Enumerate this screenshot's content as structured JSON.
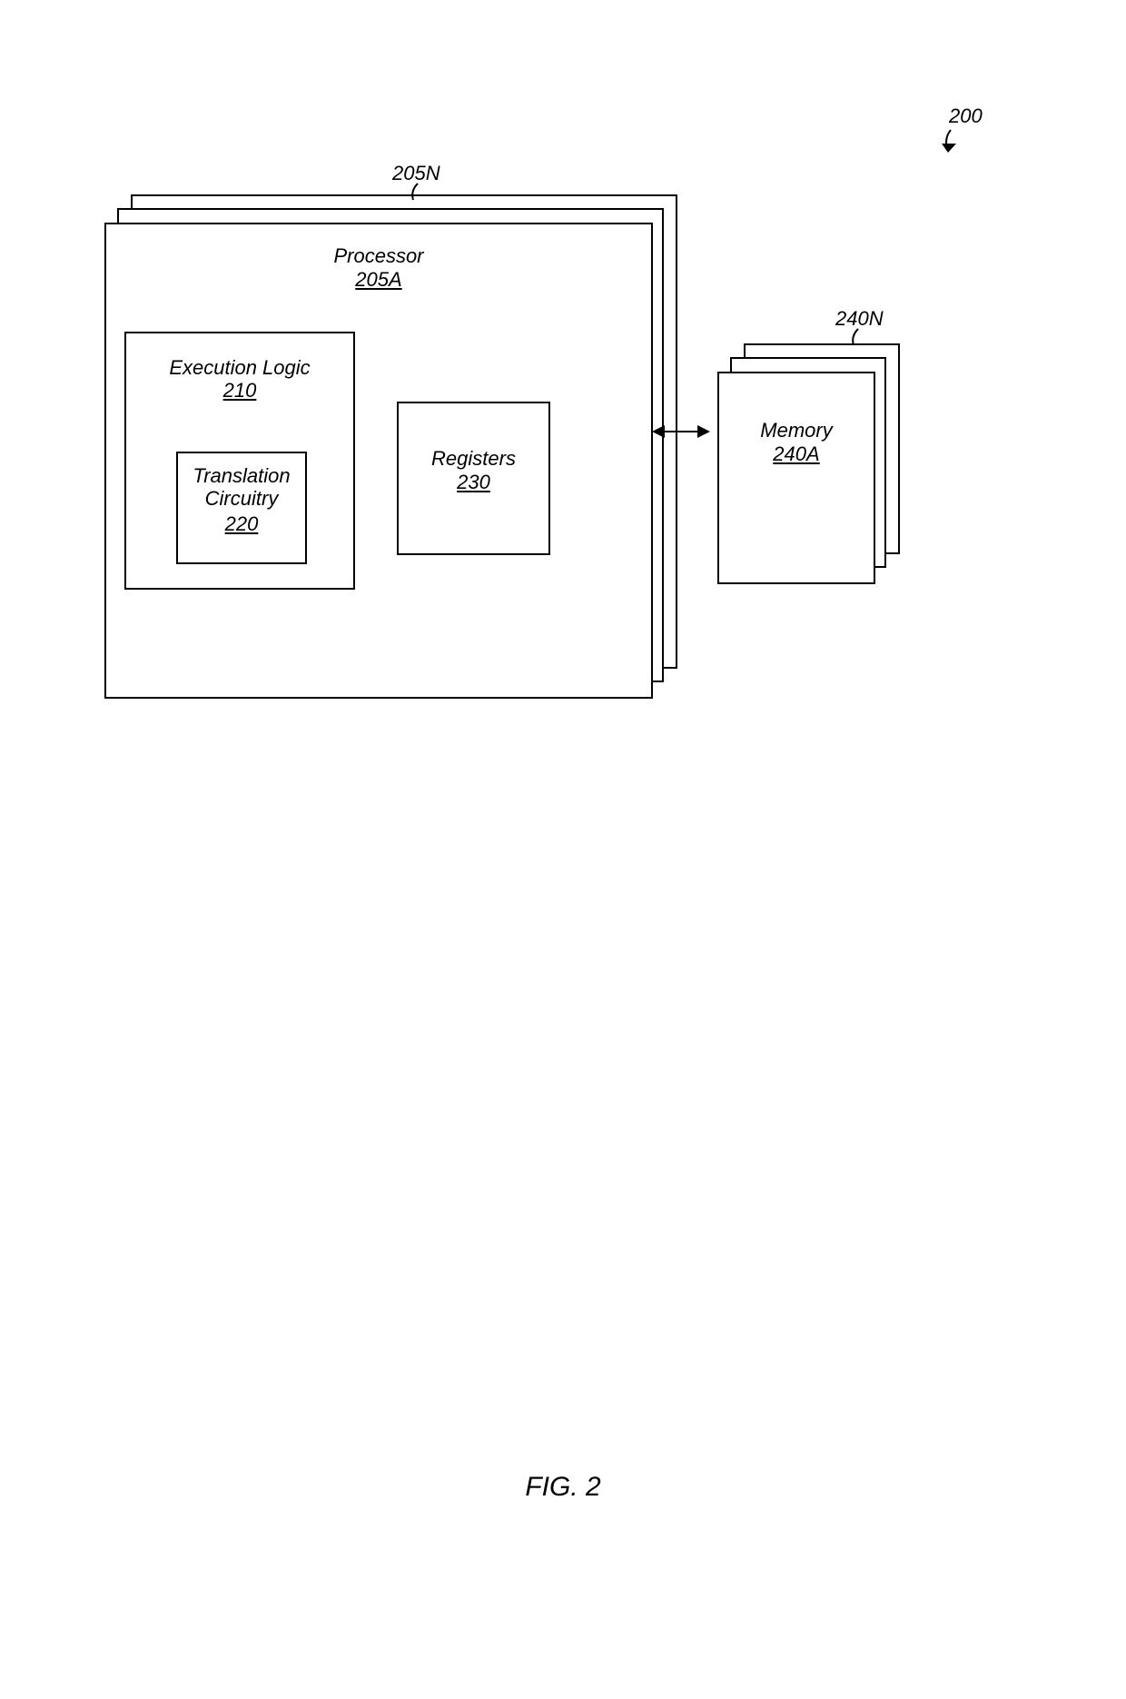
{
  "figure": {
    "overall_ref": "200",
    "caption": "FIG. 2",
    "processors": {
      "stack_ref": "205N",
      "front": {
        "title": "Processor",
        "ref": "205A",
        "execution_logic": {
          "title": "Execution Logic",
          "ref": "210",
          "translation": {
            "title1": "Translation",
            "title2": "Circuitry",
            "ref": "220"
          }
        },
        "registers": {
          "title": "Registers",
          "ref": "230"
        }
      }
    },
    "memories": {
      "stack_ref": "240N",
      "front": {
        "title": "Memory",
        "ref": "240A"
      }
    }
  }
}
